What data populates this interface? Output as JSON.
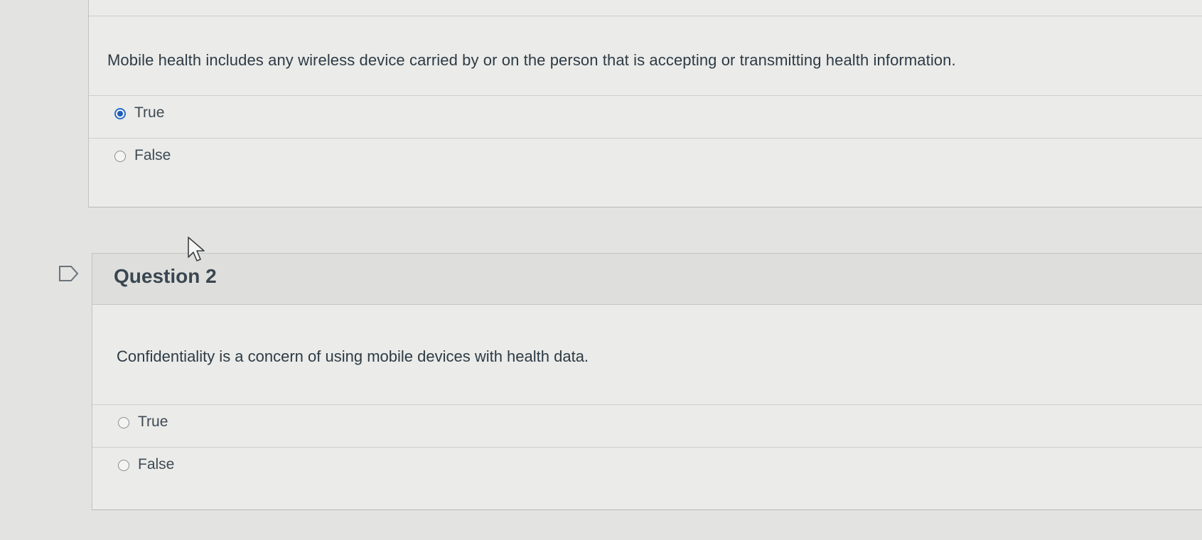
{
  "question1": {
    "text": "Mobile health includes any wireless device carried by or on the person that is accepting or transmitting health information.",
    "answers": [
      {
        "label": "True",
        "selected": true
      },
      {
        "label": "False",
        "selected": false
      }
    ]
  },
  "question2": {
    "title": "Question 2",
    "text": "Confidentiality is a concern of using  mobile devices with health data.",
    "answers": [
      {
        "label": "True",
        "selected": false
      },
      {
        "label": "False",
        "selected": false
      }
    ]
  },
  "icons": {
    "question_marker": "flag-outline-icon",
    "cursor": "mouse-pointer-icon"
  },
  "colors": {
    "selected_radio": "#1f5fb8",
    "page_background": "#e3e3e1",
    "card_background": "#ebebe9",
    "header_background": "#dedfdd"
  }
}
